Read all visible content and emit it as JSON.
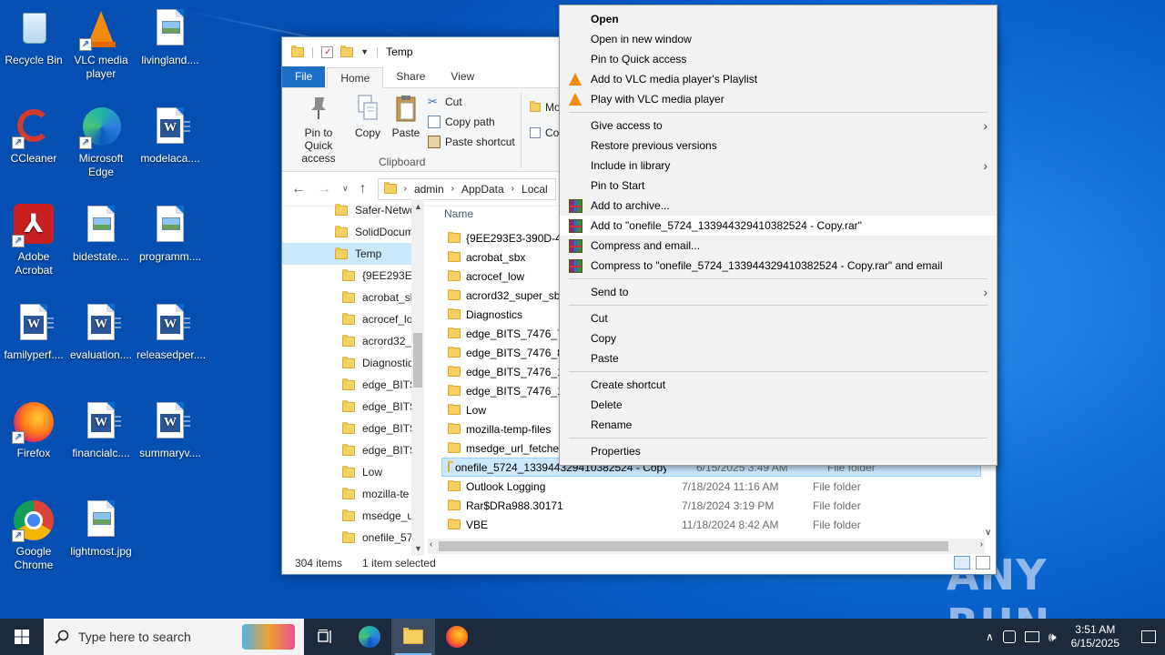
{
  "desktop": {
    "icons": [
      {
        "label": "Recycle Bin",
        "icon": "recycle-bin-icon"
      },
      {
        "label": "VLC media player",
        "icon": "vlc-icon"
      },
      {
        "label": "livingland....",
        "icon": "image-file-icon"
      },
      {
        "label": "CCleaner",
        "icon": "ccleaner-icon"
      },
      {
        "label": "Microsoft Edge",
        "icon": "edge-icon"
      },
      {
        "label": "modelaca....",
        "icon": "word-doc-icon"
      },
      {
        "label": "Adobe Acrobat",
        "icon": "acrobat-icon"
      },
      {
        "label": "bidestate....",
        "icon": "image-file-icon"
      },
      {
        "label": "programm....",
        "icon": "image-file-icon"
      },
      {
        "label": "familyperf....",
        "icon": "word-doc-icon"
      },
      {
        "label": "evaluation....",
        "icon": "word-doc-icon"
      },
      {
        "label": "releasedper....",
        "icon": "word-doc-icon"
      },
      {
        "label": "Firefox",
        "icon": "firefox-icon"
      },
      {
        "label": "financialc....",
        "icon": "word-doc-icon"
      },
      {
        "label": "summaryv....",
        "icon": "word-doc-icon"
      },
      {
        "label": "Google Chrome",
        "icon": "chrome-icon"
      },
      {
        "label": "lightmost.jpg",
        "icon": "image-file-icon"
      }
    ]
  },
  "explorer": {
    "title": "Temp",
    "tabs": [
      "File",
      "Home",
      "Share",
      "View"
    ],
    "ribbon": {
      "pin_label": "Pin to Quick access",
      "copy_label": "Copy",
      "paste_label": "Paste",
      "cut_label": "Cut",
      "copy_path_label": "Copy path",
      "paste_shortcut_label": "Paste shortcut",
      "group_clipboard": "Clipboard",
      "move_partial": "Mo",
      "copy_partial": "Co"
    },
    "breadcrumb": [
      "admin",
      "AppData",
      "Local"
    ],
    "tree": [
      {
        "label": "Safer-Netwo",
        "sel": false,
        "indent": 0
      },
      {
        "label": "SolidDocum",
        "sel": false,
        "indent": 0
      },
      {
        "label": "Temp",
        "sel": true,
        "indent": 0
      },
      {
        "label": "{9EE293E3-",
        "sel": false,
        "indent": 1
      },
      {
        "label": "acrobat_sb",
        "sel": false,
        "indent": 1
      },
      {
        "label": "acrocef_lo",
        "sel": false,
        "indent": 1
      },
      {
        "label": "acrord32_s",
        "sel": false,
        "indent": 1
      },
      {
        "label": "Diagnostic",
        "sel": false,
        "indent": 1
      },
      {
        "label": "edge_BITS_",
        "sel": false,
        "indent": 1
      },
      {
        "label": "edge_BITS_",
        "sel": false,
        "indent": 1
      },
      {
        "label": "edge_BITS_",
        "sel": false,
        "indent": 1
      },
      {
        "label": "edge_BITS_",
        "sel": false,
        "indent": 1
      },
      {
        "label": "Low",
        "sel": false,
        "indent": 1
      },
      {
        "label": "mozilla-te",
        "sel": false,
        "indent": 1
      },
      {
        "label": "msedge_u",
        "sel": false,
        "indent": 1
      },
      {
        "label": "onefile_57",
        "sel": false,
        "indent": 1
      }
    ],
    "column_name": "Name",
    "files": [
      {
        "name": "{9EE293E3-390D-48F",
        "date": "",
        "type": ""
      },
      {
        "name": "acrobat_sbx",
        "date": "",
        "type": ""
      },
      {
        "name": "acrocef_low",
        "date": "",
        "type": ""
      },
      {
        "name": "acrord32_super_sbx",
        "date": "",
        "type": ""
      },
      {
        "name": "Diagnostics",
        "date": "",
        "type": ""
      },
      {
        "name": "edge_BITS_7476_718",
        "date": "",
        "type": ""
      },
      {
        "name": "edge_BITS_7476_817",
        "date": "",
        "type": ""
      },
      {
        "name": "edge_BITS_7476_146",
        "date": "",
        "type": ""
      },
      {
        "name": "edge_BITS_7476_194",
        "date": "",
        "type": ""
      },
      {
        "name": "Low",
        "date": "",
        "type": ""
      },
      {
        "name": "mozilla-temp-files",
        "date": "",
        "type": ""
      },
      {
        "name": "msedge_url_fetcher_",
        "date": "",
        "type": ""
      },
      {
        "name": "onefile_5724_133944329410382524 - Copy",
        "date": "6/15/2025 3:49 AM",
        "type": "File folder"
      },
      {
        "name": "Outlook Logging",
        "date": "7/18/2024 11:16 AM",
        "type": "File folder"
      },
      {
        "name": "Rar$DRa988.30171",
        "date": "7/18/2024 3:19 PM",
        "type": "File folder"
      },
      {
        "name": "VBE",
        "date": "11/18/2024 8:42 AM",
        "type": "File folder"
      }
    ],
    "selected_index": 12,
    "status_items": "304 items",
    "status_selected": "1 item selected"
  },
  "context_menu": {
    "items": [
      {
        "label": "Open",
        "bold": true,
        "icon": "",
        "arrow": false
      },
      {
        "label": "Open in new window",
        "icon": "",
        "arrow": false
      },
      {
        "label": "Pin to Quick access",
        "icon": "",
        "arrow": false
      },
      {
        "label": "Add to VLC media player's Playlist",
        "icon": "vlc",
        "arrow": false
      },
      {
        "label": "Play with VLC media player",
        "icon": "vlc",
        "arrow": false
      },
      {
        "sep": true
      },
      {
        "label": "Give access to",
        "icon": "",
        "arrow": true
      },
      {
        "label": "Restore previous versions",
        "icon": "",
        "arrow": false
      },
      {
        "label": "Include in library",
        "icon": "",
        "arrow": true
      },
      {
        "label": "Pin to Start",
        "icon": "",
        "arrow": false
      },
      {
        "label": "Add to archive...",
        "icon": "rar",
        "arrow": false
      },
      {
        "label": "Add to \"onefile_5724_133944329410382524 - Copy.rar\"",
        "icon": "rar",
        "arrow": false,
        "hl": true
      },
      {
        "label": "Compress and email...",
        "icon": "rar",
        "arrow": false
      },
      {
        "label": "Compress to \"onefile_5724_133944329410382524 - Copy.rar\" and email",
        "icon": "rar",
        "arrow": false
      },
      {
        "sep": true
      },
      {
        "label": "Send to",
        "icon": "",
        "arrow": true
      },
      {
        "sep": true
      },
      {
        "label": "Cut",
        "icon": "",
        "arrow": false
      },
      {
        "label": "Copy",
        "icon": "",
        "arrow": false
      },
      {
        "label": "Paste",
        "icon": "",
        "arrow": false
      },
      {
        "sep": true
      },
      {
        "label": "Create shortcut",
        "icon": "",
        "arrow": false
      },
      {
        "label": "Delete",
        "icon": "",
        "arrow": false
      },
      {
        "label": "Rename",
        "icon": "",
        "arrow": false
      },
      {
        "sep": true
      },
      {
        "label": "Properties",
        "icon": "",
        "arrow": false
      }
    ]
  },
  "taskbar": {
    "search_placeholder": "Type here to search",
    "time": "3:51 AM",
    "date": "6/15/2025"
  },
  "watermark": "ANY RUN",
  "colors": {
    "accent": "#1e6fc8",
    "selection": "#cce8ff",
    "folder": "#f5cf62",
    "taskbar": "#1c2a3c"
  }
}
